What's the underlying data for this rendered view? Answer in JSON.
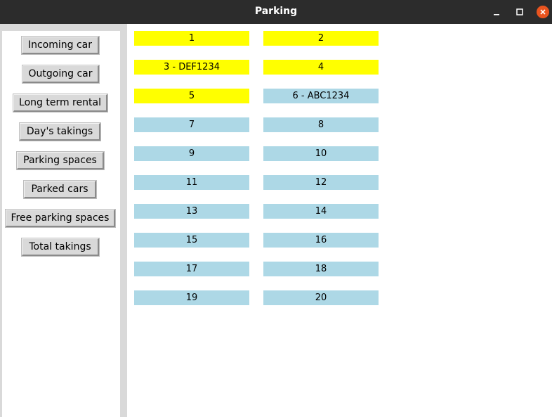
{
  "window": {
    "title": "Parking"
  },
  "sidebar": {
    "buttons": [
      {
        "label": "Incoming car"
      },
      {
        "label": "Outgoing car"
      },
      {
        "label": "Long term rental"
      },
      {
        "label": "Day's takings"
      },
      {
        "label": "Parking spaces"
      },
      {
        "label": "Parked cars"
      },
      {
        "label": "Free parking spaces"
      },
      {
        "label": "Total takings"
      }
    ]
  },
  "colors": {
    "occupied": "#ffff00",
    "free": "#add8e6",
    "titlebar": "#2c2c2c",
    "close": "#e9541f"
  },
  "spots": [
    {
      "label": "1",
      "status": "occupied"
    },
    {
      "label": "2",
      "status": "occupied"
    },
    {
      "label": "3 - DEF1234",
      "status": "occupied"
    },
    {
      "label": "4",
      "status": "occupied"
    },
    {
      "label": "5",
      "status": "occupied"
    },
    {
      "label": "6 - ABC1234",
      "status": "free"
    },
    {
      "label": "7",
      "status": "free"
    },
    {
      "label": "8",
      "status": "free"
    },
    {
      "label": "9",
      "status": "free"
    },
    {
      "label": "10",
      "status": "free"
    },
    {
      "label": "11",
      "status": "free"
    },
    {
      "label": "12",
      "status": "free"
    },
    {
      "label": "13",
      "status": "free"
    },
    {
      "label": "14",
      "status": "free"
    },
    {
      "label": "15",
      "status": "free"
    },
    {
      "label": "16",
      "status": "free"
    },
    {
      "label": "17",
      "status": "free"
    },
    {
      "label": "18",
      "status": "free"
    },
    {
      "label": "19",
      "status": "free"
    },
    {
      "label": "20",
      "status": "free"
    }
  ]
}
